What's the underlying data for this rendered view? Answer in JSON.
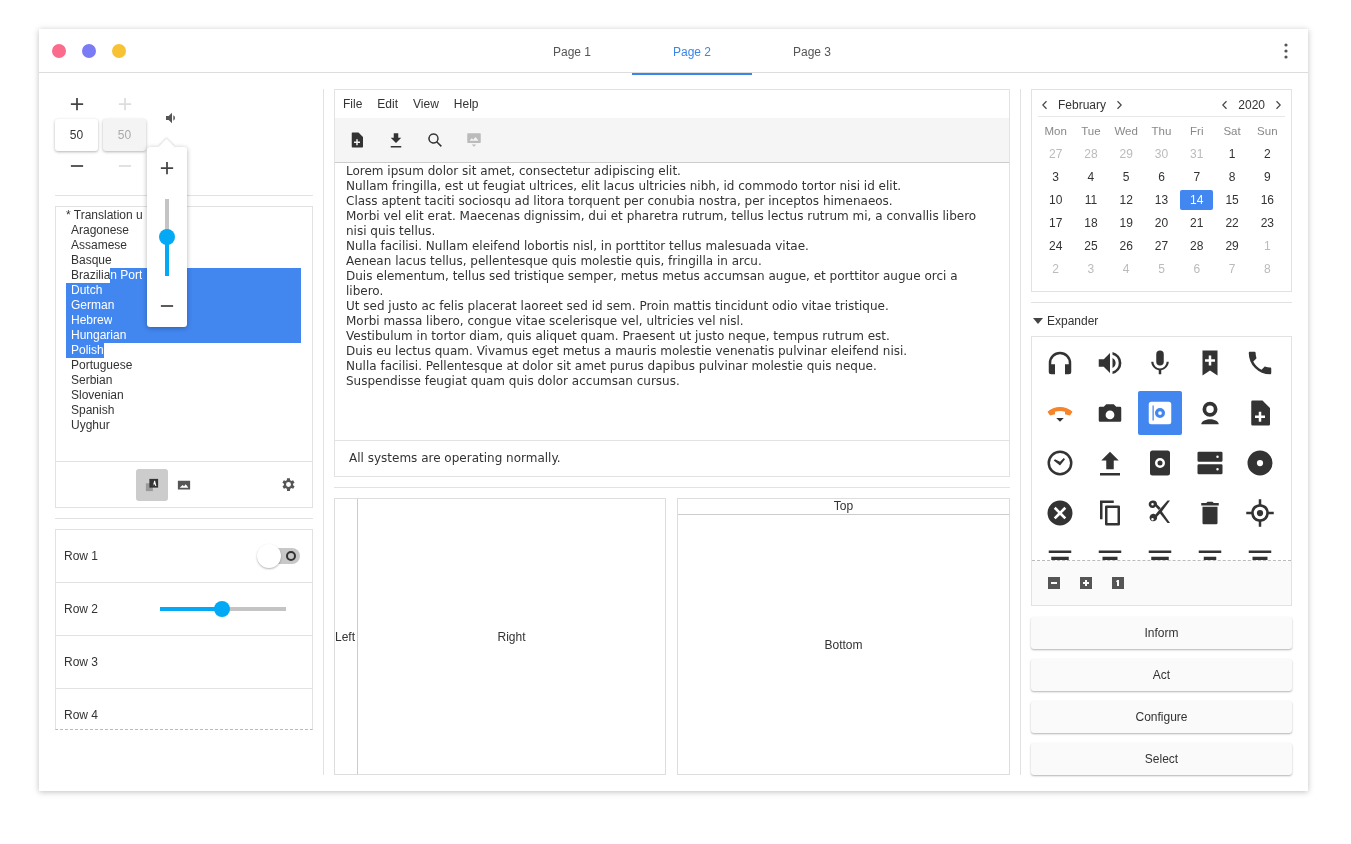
{
  "window": {
    "controls": [
      {
        "color": "#fb6b8b"
      },
      {
        "color": "#7b7bf6"
      },
      {
        "color": "#f7c234"
      }
    ]
  },
  "tabs": [
    {
      "label": "Page 1",
      "selected": false
    },
    {
      "label": "Page 2",
      "selected": true
    },
    {
      "label": "Page 3",
      "selected": false
    }
  ],
  "spin_buttons": [
    {
      "value": "50",
      "disabled": false
    },
    {
      "value": "50",
      "disabled": true
    }
  ],
  "volume_popover": {
    "level": 0.5
  },
  "language_list": {
    "lines": [
      {
        "kind": "heading",
        "selected_eol": false,
        "parts": [
          {
            "text": "* Translation u",
            "selected": false
          }
        ]
      },
      {
        "kind": "item",
        "selected_eol": false,
        "parts": [
          {
            "text": "Aragonese",
            "selected": false
          }
        ]
      },
      {
        "kind": "item",
        "selected_eol": false,
        "parts": [
          {
            "text": "Assamese",
            "selected": false
          }
        ]
      },
      {
        "kind": "item",
        "selected_eol": false,
        "parts": [
          {
            "text": "Basque",
            "selected": false
          }
        ]
      },
      {
        "kind": "item",
        "selected_eol": true,
        "parts": [
          {
            "text": "Brazilia",
            "selected": false
          },
          {
            "text": "n Port",
            "selected": true
          }
        ]
      },
      {
        "kind": "item",
        "selected_eol": true,
        "parts": [
          {
            "text": "Dutch",
            "selected": true
          }
        ]
      },
      {
        "kind": "item",
        "selected_eol": true,
        "parts": [
          {
            "text": "German",
            "selected": true
          }
        ]
      },
      {
        "kind": "item",
        "selected_eol": true,
        "parts": [
          {
            "text": "Hebrew",
            "selected": true
          }
        ]
      },
      {
        "kind": "item",
        "selected_eol": true,
        "parts": [
          {
            "text": "Hungarian",
            "selected": true
          }
        ]
      },
      {
        "kind": "item",
        "selected_eol": false,
        "parts": [
          {
            "text": "Polish",
            "selected": true
          }
        ]
      },
      {
        "kind": "item",
        "selected_eol": false,
        "parts": [
          {
            "text": "Portuguese",
            "selected": false
          }
        ]
      },
      {
        "kind": "item",
        "selected_eol": false,
        "parts": [
          {
            "text": "Serbian",
            "selected": false
          }
        ]
      },
      {
        "kind": "item",
        "selected_eol": false,
        "parts": [
          {
            "text": "Slovenian",
            "selected": false
          }
        ]
      },
      {
        "kind": "item",
        "selected_eol": false,
        "parts": [
          {
            "text": "Spanish",
            "selected": false
          }
        ]
      },
      {
        "kind": "item",
        "selected_eol": false,
        "parts": [
          {
            "text": "Uyghur",
            "selected": false
          }
        ]
      }
    ],
    "toggles": [
      {
        "selected": true
      },
      {
        "selected": false
      }
    ]
  },
  "rows": [
    {
      "label": "Row 1",
      "kind": "switch",
      "checked": false
    },
    {
      "label": "Row 2",
      "kind": "slider",
      "level": 0.49
    },
    {
      "label": "Row 3",
      "kind": "plain"
    },
    {
      "label": "Row 4",
      "kind": "plain"
    }
  ],
  "editor": {
    "menu": [
      "File",
      "Edit",
      "View",
      "Help"
    ],
    "tools": [
      {
        "disabled": false
      },
      {
        "disabled": false
      },
      {
        "disabled": false
      },
      {
        "disabled": true
      }
    ],
    "paragraphs": [
      "Lorem ipsum dolor sit amet, consectetur adipiscing elit.",
      "Nullam fringilla, est ut feugiat ultrices, elit lacus ultricies nibh, id commodo tortor nisi id elit.",
      "Class aptent taciti sociosqu ad litora torquent per conubia nostra, per inceptos himenaeos.",
      "Morbi vel elit erat. Maecenas dignissim, dui et pharetra rutrum, tellus lectus rutrum mi, a convallis libero nisi quis tellus.",
      "Nulla facilisi. Nullam eleifend lobortis nisl, in porttitor tellus malesuada vitae.",
      "Aenean lacus tellus, pellentesque quis molestie quis, fringilla in arcu.",
      "Duis elementum, tellus sed tristique semper, metus metus accumsan augue, et porttitor augue orci a libero.",
      "Ut sed justo ac felis placerat laoreet sed id sem. Proin mattis tincidunt odio vitae tristique.",
      "Morbi massa libero, congue vitae scelerisque vel, ultricies vel nisl.",
      "Vestibulum in tortor diam, quis aliquet quam. Praesent ut justo neque, tempus rutrum est.",
      "Duis eu lectus quam. Vivamus eget metus a mauris molestie venenatis pulvinar eleifend nisi.",
      "Nulla facilisi. Pellentesque at dolor sit amet purus dapibus pulvinar molestie quis neque.",
      "Suspendisse feugiat quam quis dolor accumsan cursus."
    ],
    "status": "All systems are operating normally."
  },
  "panes": {
    "left": "Left",
    "right": "Right",
    "top": "Top",
    "bottom": "Bottom"
  },
  "calendar": {
    "month": "February",
    "year": "2020",
    "weekdays": [
      "Mon",
      "Tue",
      "Wed",
      "Thu",
      "Fri",
      "Sat",
      "Sun"
    ],
    "weeks": [
      [
        {
          "day": "27",
          "other_month": true,
          "selected": false
        },
        {
          "day": "28",
          "other_month": true,
          "selected": false
        },
        {
          "day": "29",
          "other_month": true,
          "selected": false
        },
        {
          "day": "30",
          "other_month": true,
          "selected": false
        },
        {
          "day": "31",
          "other_month": true,
          "selected": false
        },
        {
          "day": "1",
          "other_month": false,
          "selected": false
        },
        {
          "day": "2",
          "other_month": false,
          "selected": false
        }
      ],
      [
        {
          "day": "3",
          "other_month": false,
          "selected": false
        },
        {
          "day": "4",
          "other_month": false,
          "selected": false
        },
        {
          "day": "5",
          "other_month": false,
          "selected": false
        },
        {
          "day": "6",
          "other_month": false,
          "selected": false
        },
        {
          "day": "7",
          "other_month": false,
          "selected": false
        },
        {
          "day": "8",
          "other_month": false,
          "selected": false
        },
        {
          "day": "9",
          "other_month": false,
          "selected": false
        }
      ],
      [
        {
          "day": "10",
          "other_month": false,
          "selected": false
        },
        {
          "day": "11",
          "other_month": false,
          "selected": false
        },
        {
          "day": "12",
          "other_month": false,
          "selected": false
        },
        {
          "day": "13",
          "other_month": false,
          "selected": false
        },
        {
          "day": "14",
          "other_month": false,
          "selected": true
        },
        {
          "day": "15",
          "other_month": false,
          "selected": false
        },
        {
          "day": "16",
          "other_month": false,
          "selected": false
        }
      ],
      [
        {
          "day": "17",
          "other_month": false,
          "selected": false
        },
        {
          "day": "18",
          "other_month": false,
          "selected": false
        },
        {
          "day": "19",
          "other_month": false,
          "selected": false
        },
        {
          "day": "20",
          "other_month": false,
          "selected": false
        },
        {
          "day": "21",
          "other_month": false,
          "selected": false
        },
        {
          "day": "22",
          "other_month": false,
          "selected": false
        },
        {
          "day": "23",
          "other_month": false,
          "selected": false
        }
      ],
      [
        {
          "day": "24",
          "other_month": false,
          "selected": false
        },
        {
          "day": "25",
          "other_month": false,
          "selected": false
        },
        {
          "day": "26",
          "other_month": false,
          "selected": false
        },
        {
          "day": "27",
          "other_month": false,
          "selected": false
        },
        {
          "day": "28",
          "other_month": false,
          "selected": false
        },
        {
          "day": "29",
          "other_month": false,
          "selected": false
        },
        {
          "day": "1",
          "other_month": true,
          "selected": false
        }
      ],
      [
        {
          "day": "2",
          "other_month": true,
          "selected": false
        },
        {
          "day": "3",
          "other_month": true,
          "selected": false
        },
        {
          "day": "4",
          "other_month": true,
          "selected": false
        },
        {
          "day": "5",
          "other_month": true,
          "selected": false
        },
        {
          "day": "6",
          "other_month": true,
          "selected": false
        },
        {
          "day": "7",
          "other_month": true,
          "selected": false
        },
        {
          "day": "8",
          "other_month": true,
          "selected": false
        }
      ]
    ]
  },
  "expander": {
    "label": "Expander",
    "expanded": true,
    "icons": [
      {
        "selected": false
      },
      {
        "selected": false
      },
      {
        "selected": false
      },
      {
        "selected": false
      },
      {
        "selected": false
      },
      {
        "selected": false
      },
      {
        "selected": false
      },
      {
        "selected": true
      },
      {
        "selected": false
      },
      {
        "selected": false
      },
      {
        "selected": false
      },
      {
        "selected": false
      },
      {
        "selected": false
      },
      {
        "selected": false
      },
      {
        "selected": false
      },
      {
        "selected": false
      },
      {
        "selected": false
      },
      {
        "selected": false
      },
      {
        "selected": false
      },
      {
        "selected": false
      },
      {
        "selected": false
      },
      {
        "selected": false
      },
      {
        "selected": false
      },
      {
        "selected": false
      },
      {
        "selected": false
      }
    ]
  },
  "buttons": [
    "Inform",
    "Act",
    "Configure",
    "Select"
  ]
}
